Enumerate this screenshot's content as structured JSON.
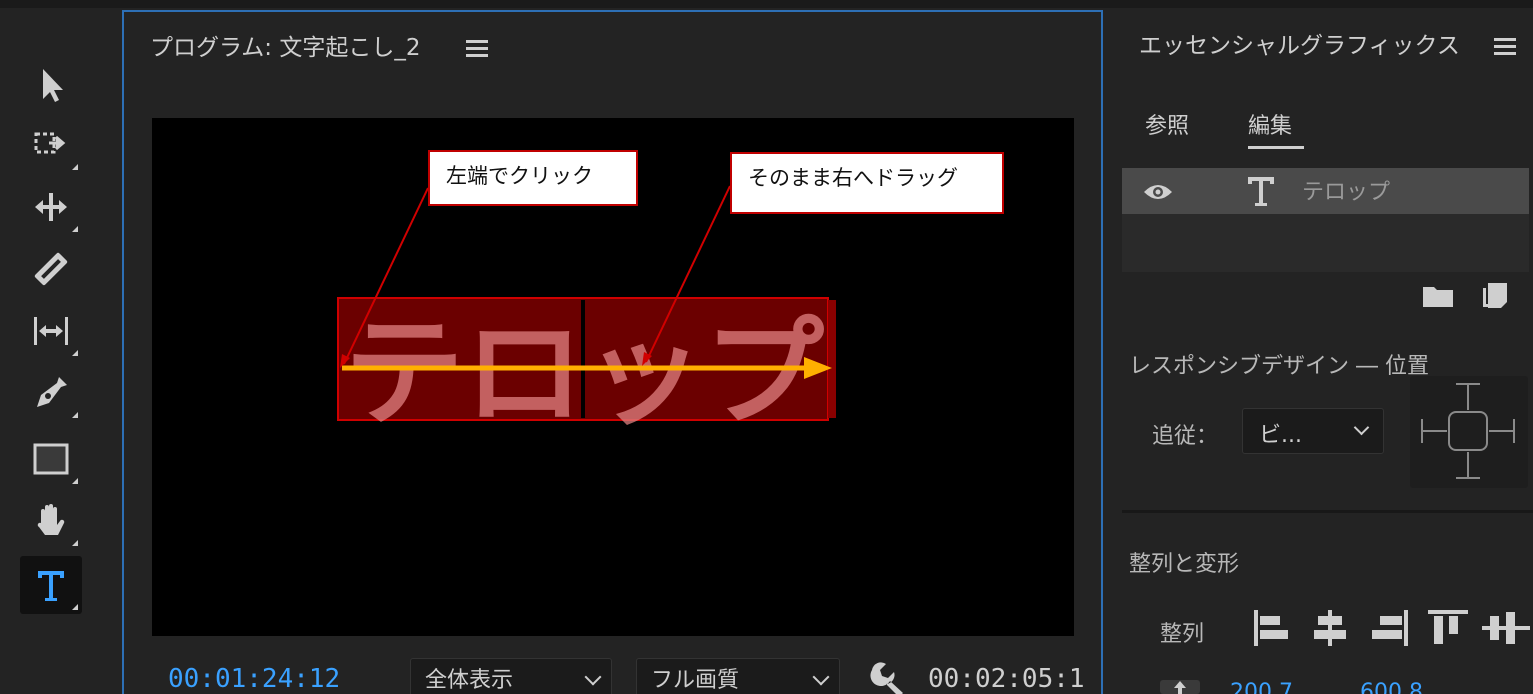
{
  "program": {
    "title": "プログラム: 文字起こし_2",
    "canvas_text": "テロップ",
    "timecode_current": "00:01:24:12",
    "timecode_duration": "00:02:05:1",
    "zoom_select": "全体表示",
    "quality_select": "フル画質"
  },
  "tools": [
    {
      "name": "selection-tool",
      "icon": "arrow-icon"
    },
    {
      "name": "track-select-tool",
      "icon": "track-select-icon"
    },
    {
      "name": "ripple-edit-tool",
      "icon": "ripple-edit-icon"
    },
    {
      "name": "razor-tool",
      "icon": "razor-icon"
    },
    {
      "name": "slip-tool",
      "icon": "slip-icon"
    },
    {
      "name": "pen-tool",
      "icon": "pen-icon"
    },
    {
      "name": "rectangle-tool",
      "icon": "rectangle-icon"
    },
    {
      "name": "hand-tool",
      "icon": "hand-icon"
    },
    {
      "name": "type-tool",
      "icon": "type-icon",
      "active": true
    }
  ],
  "essential_graphics": {
    "title": "エッセンシャルグラフィックス",
    "tabs": [
      "参照",
      "編集"
    ],
    "active_tab": "編集",
    "layer_name": "テロップ",
    "responsive_label": "レスポンシブデザイン ― 位置",
    "follow_label": "追従：",
    "follow_value": "ビ...",
    "align_transform_label": "整列と変形",
    "align_label": "整列",
    "value_1": "200.7",
    "value_2": "600.8"
  },
  "annotations": {
    "callout_left": "左端でクリック",
    "callout_right": "そのまま右へドラッグ"
  },
  "colors": {
    "accent_blue": "#3aa1ff",
    "panel_border": "#2d6fb5",
    "text_box_fill": "#6b0000",
    "drag_arrow": "#ffb000",
    "callout_border": "#c00000"
  }
}
